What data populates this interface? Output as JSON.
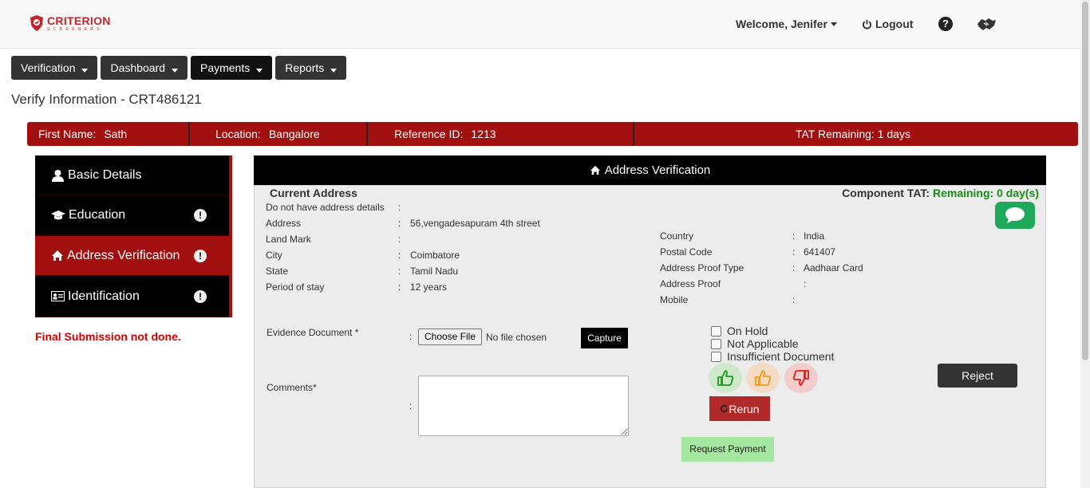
{
  "header": {
    "logo_text": "CRITERION",
    "logo_subtext": "SCREENERS",
    "welcome": "Welcome, Jenifer",
    "logout": "Logout"
  },
  "nav": [
    {
      "label": "Verification"
    },
    {
      "label": "Dashboard"
    },
    {
      "label": "Payments"
    },
    {
      "label": "Reports"
    }
  ],
  "page_title": "Verify Information - CRT486121",
  "info_bar": {
    "first_name_label": "First Name:",
    "first_name": "Sath",
    "location_label": "Location:",
    "location": "Bangalore",
    "ref_label": "Reference ID:",
    "ref": "1213",
    "tat": "TAT Remaining: 1 days"
  },
  "sidebar": {
    "items": [
      {
        "label": "Basic Details"
      },
      {
        "label": "Education"
      },
      {
        "label": "Address Verification"
      },
      {
        "label": "Identification"
      }
    ],
    "final_note": "Final Submission not done."
  },
  "panel": {
    "title": "Address Verification",
    "section": "Current Address",
    "tat_label": "Component TAT:",
    "tat_value": "Remaining: 0 day(s)",
    "left_fields": [
      {
        "label": "Do not have address details",
        "value": ""
      },
      {
        "label": "Address",
        "value": "56,vengadesapuram 4th street"
      },
      {
        "label": "Land Mark",
        "value": ""
      },
      {
        "label": "City",
        "value": "Coimbatore"
      },
      {
        "label": "State",
        "value": "Tamil Nadu"
      },
      {
        "label": "Period of stay",
        "value": "12 years"
      }
    ],
    "right_fields": [
      {
        "label": "Country",
        "value": "India"
      },
      {
        "label": "Postal Code",
        "value": "641407"
      },
      {
        "label": "Address Proof Type",
        "value": "Aadhaar Card"
      },
      {
        "label": "Address Proof",
        "value": ""
      },
      {
        "label": "Mobile",
        "value": ""
      }
    ],
    "colon": ":",
    "evidence_label": "Evidence Document *",
    "choose_file": "Choose File",
    "no_file": "No file chosen",
    "capture": "Capture",
    "comments_label": "Comments*",
    "checks": [
      {
        "label": "On Hold"
      },
      {
        "label": "Not Applicable"
      },
      {
        "label": "Insufficient Document"
      }
    ],
    "rerun": "Rerun",
    "reject": "Reject",
    "request_payment": "Request Payment"
  }
}
